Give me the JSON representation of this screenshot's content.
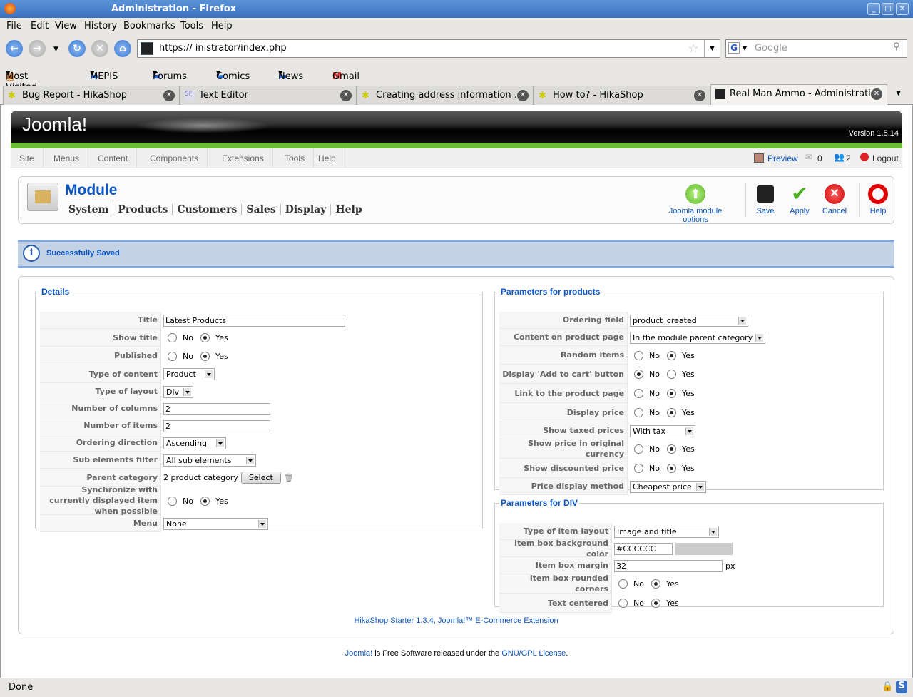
{
  "window": {
    "title": "Administration - Firefox"
  },
  "menu": [
    "File",
    "Edit",
    "View",
    "History",
    "Bookmarks",
    "Tools",
    "Help"
  ],
  "url": "https://                          inistrator/index.php",
  "search_placeholder": "Google",
  "bookmarks": [
    "Most Visited",
    "MEPIS",
    "Forums",
    "Comics",
    "News",
    "Gmail"
  ],
  "tabs": [
    {
      "label": "Bug Report - HikaShop"
    },
    {
      "label": "Text Editor"
    },
    {
      "label": "Creating address information ..."
    },
    {
      "label": "How to? - HikaShop"
    },
    {
      "label": "Real Man Ammo - Administration",
      "active": true
    }
  ],
  "joomla": {
    "logo": "Joomla!",
    "version": "Version 1.5.14",
    "menu": [
      "Site",
      "Menus",
      "Content",
      "Components",
      "Extensions",
      "Tools",
      "Help"
    ],
    "preview": "Preview",
    "messages": "0",
    "users": "2",
    "logout": "Logout"
  },
  "toolbar": {
    "title": "Module",
    "subnav": [
      "System",
      "Products",
      "Customers",
      "Sales",
      "Display",
      "Help"
    ],
    "options": "Joomla module options",
    "save": "Save",
    "apply": "Apply",
    "cancel": "Cancel",
    "help": "Help"
  },
  "message": "Successfully Saved",
  "details": {
    "legend": "Details",
    "rows": [
      {
        "label": "Title",
        "type": "text",
        "value": "Latest Products"
      },
      {
        "label": "Show title",
        "type": "radio",
        "value": "Yes"
      },
      {
        "label": "Published",
        "type": "radio",
        "value": "Yes"
      },
      {
        "label": "Type of content",
        "type": "select",
        "value": "Product"
      },
      {
        "label": "Type of layout",
        "type": "select",
        "value": "Div"
      },
      {
        "label": "Number of columns",
        "type": "text",
        "value": "2"
      },
      {
        "label": "Number of items",
        "type": "text",
        "value": "2"
      },
      {
        "label": "Ordering direction",
        "type": "select",
        "value": "Ascending"
      },
      {
        "label": "Sub elements filter",
        "type": "select",
        "value": "All sub elements"
      },
      {
        "label": "Parent category",
        "type": "category",
        "value": "2 product category",
        "button": "Select"
      },
      {
        "label": "Synchronize with currently displayed item when possible",
        "type": "radio",
        "value": "Yes"
      },
      {
        "label": "Menu",
        "type": "select",
        "value": "None"
      }
    ]
  },
  "products": {
    "legend": "Parameters for products",
    "rows": [
      {
        "label": "Ordering field",
        "type": "select",
        "value": "product_created"
      },
      {
        "label": "Content on product page",
        "type": "select",
        "value": "In the module parent category"
      },
      {
        "label": "Random items",
        "type": "radio",
        "value": "Yes"
      },
      {
        "label": "Display 'Add to cart' button",
        "type": "radio",
        "value": "No"
      },
      {
        "label": "Link to the product page",
        "type": "radio",
        "value": "Yes"
      },
      {
        "label": "Display price",
        "type": "radio",
        "value": "Yes"
      },
      {
        "label": "Show taxed prices",
        "type": "select",
        "value": "With tax"
      },
      {
        "label": "Show price in original currency",
        "type": "radio",
        "value": "Yes"
      },
      {
        "label": "Show discounted price",
        "type": "radio",
        "value": "Yes"
      },
      {
        "label": "Price display method",
        "type": "select",
        "value": "Cheapest price"
      }
    ]
  },
  "div": {
    "legend": "Parameters for DIV",
    "rows": [
      {
        "label": "Type of item layout",
        "type": "select",
        "value": "Image and title"
      },
      {
        "label": "Item box background color",
        "type": "color",
        "value": "#CCCCCC"
      },
      {
        "label": "Item box margin",
        "type": "text",
        "value": "32",
        "suffix": "px"
      },
      {
        "label": "Item box rounded corners",
        "type": "radio",
        "value": "Yes"
      },
      {
        "label": "Text centered",
        "type": "radio",
        "value": "Yes"
      }
    ]
  },
  "radio_labels": {
    "no": "No",
    "yes": "Yes"
  },
  "footer": {
    "hika_link": "HikaShop Starter 1.3.4, Joomla!™ E-Commerce Extension",
    "joomla_link": "Joomla!",
    "text": " is Free Software released under the ",
    "license_link": "GNU/GPL License",
    "end": "."
  },
  "statusbar": "Done"
}
